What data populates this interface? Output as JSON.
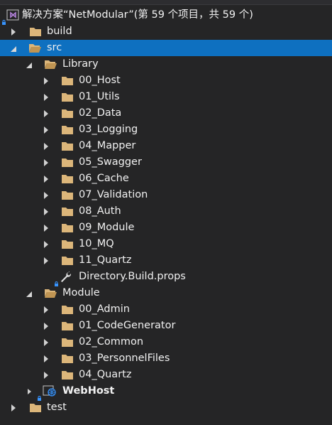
{
  "solution": {
    "label": "解决方案“NetModular”(第 59 个项目，共 59 个)"
  },
  "tree": {
    "build": "build",
    "src": "src",
    "library": {
      "label": "Library",
      "items": [
        "00_Host",
        "01_Utils",
        "02_Data",
        "03_Logging",
        "04_Mapper",
        "05_Swagger",
        "06_Cache",
        "07_Validation",
        "08_Auth",
        "09_Module",
        "10_MQ",
        "11_Quartz"
      ],
      "props_file": "Directory.Build.props"
    },
    "module": {
      "label": "Module",
      "items": [
        "00_Admin",
        "01_CodeGenerator",
        "02_Common",
        "03_PersonnelFiles",
        "04_Quartz"
      ]
    },
    "webhost": "WebHost",
    "test": "test"
  },
  "colors": {
    "background": "#252526",
    "selection": "#0e70c0",
    "folder": "#dcb67a",
    "text": "#f1f1f1",
    "lock": "#3794ff"
  }
}
